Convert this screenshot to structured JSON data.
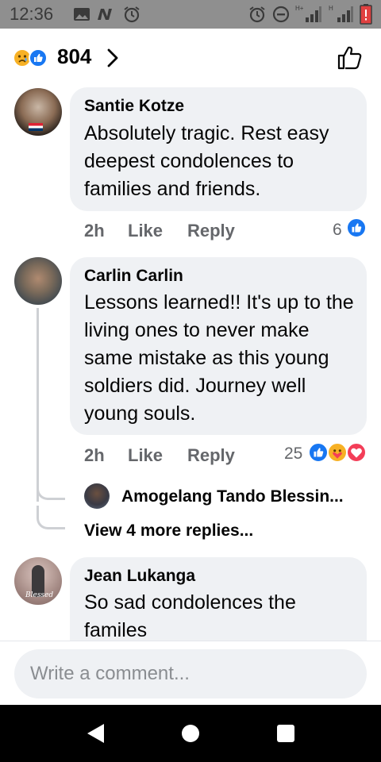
{
  "status_bar": {
    "time": "12:36",
    "left_icons": [
      "gallery-icon",
      "notification-n-icon",
      "alarm-icon"
    ],
    "right_icons": [
      "alarm-icon",
      "do-not-disturb-icon",
      "signal-icon",
      "signal-icon",
      "battery-low-icon"
    ],
    "signal_label_1": "H+",
    "signal_label_2": "H"
  },
  "reactions_header": {
    "icons": [
      "sad-reaction",
      "like-reaction"
    ],
    "count": "804",
    "colors": {
      "like": "#1877f2",
      "sad": "#f7b125"
    }
  },
  "comments": [
    {
      "author": "Santie Kotze",
      "text": "Absolutely tragic. Rest easy deepest condolences to families and friends.",
      "time": "2h",
      "like_label": "Like",
      "reply_label": "Reply",
      "reaction_count": "6",
      "reactions": [
        "like"
      ]
    },
    {
      "author": "Carlin Carlin",
      "text": "Lessons learned!! It's up to the living ones to never make same mistake as this young soldiers did. Journey well young souls.",
      "time": "2h",
      "like_label": "Like",
      "reply_label": "Reply",
      "reaction_count": "25",
      "reactions": [
        "like",
        "care",
        "love"
      ],
      "reply_preview": {
        "author": "Amogelang Tando Blessin..."
      },
      "view_more": "View 4 more replies..."
    },
    {
      "author": "Jean Lukanga",
      "text": "So sad condolences the familes",
      "avatar_caption": "Blessed"
    }
  ],
  "composer": {
    "placeholder": "Write a comment..."
  },
  "nav_bar": {
    "buttons": [
      "back-icon",
      "home-icon",
      "recents-icon"
    ]
  }
}
